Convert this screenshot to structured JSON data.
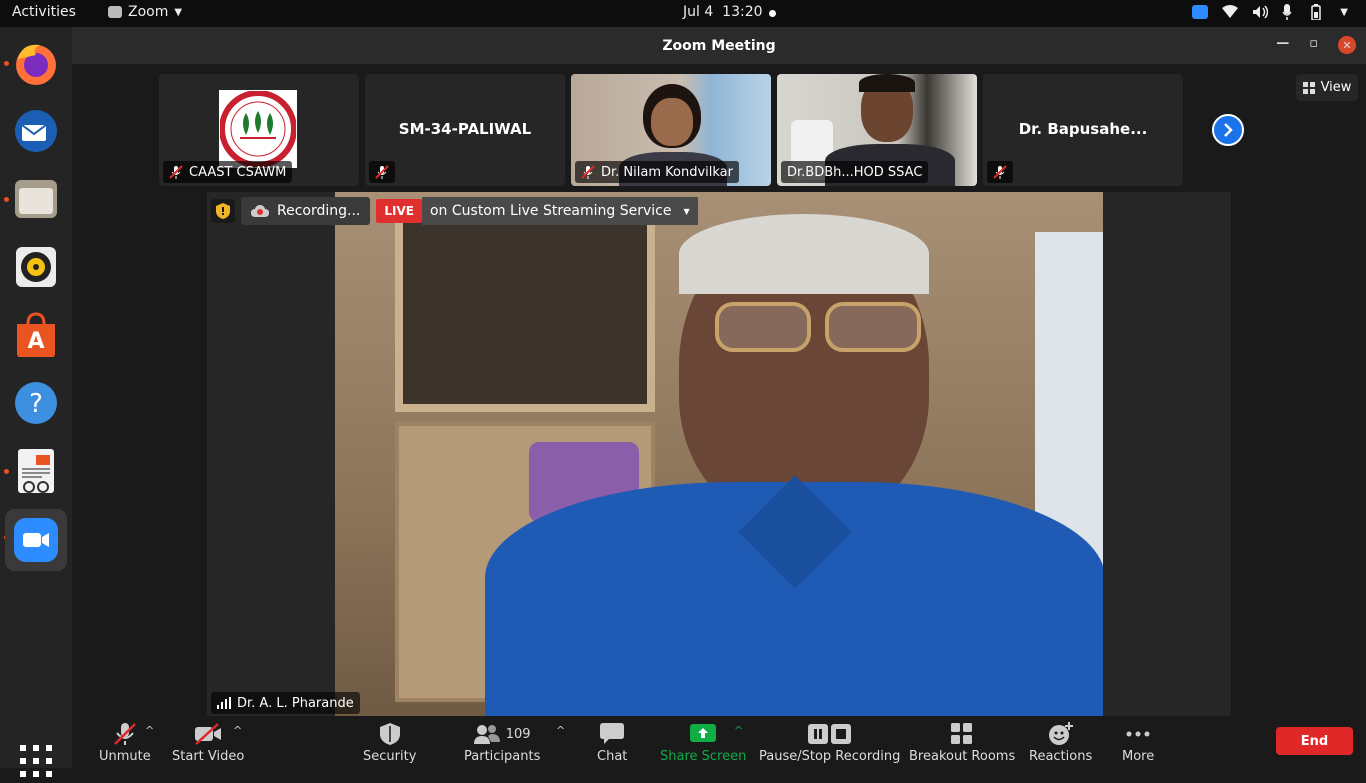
{
  "topbar": {
    "activities": "Activities",
    "app_menu": "Zoom",
    "date": "Jul 4",
    "time": "13:20"
  },
  "window": {
    "title": "Zoom Meeting"
  },
  "gallery": {
    "tiles": [
      {
        "name": "CAAST CSAWM",
        "logo_text": "अमुना सुर्ये"
      },
      {
        "name": "",
        "display": "SM-34-PALIWAL"
      },
      {
        "name": "Dr. Nilam Kondvilkar"
      },
      {
        "name": "Dr.BDBh...HOD SSAC"
      },
      {
        "name": "",
        "display": "Dr. Bapusahe..."
      }
    ],
    "view_label": "View"
  },
  "recording": {
    "label": "Recording...",
    "live": "LIVE",
    "service": "on Custom Live Streaming Service"
  },
  "speaker": {
    "name": "Dr. A. L. Pharande"
  },
  "toolbar": {
    "unmute": "Unmute",
    "start_video": "Start Video",
    "security": "Security",
    "participants": "Participants",
    "participant_count": "109",
    "chat": "Chat",
    "share_screen": "Share Screen",
    "pause_stop": "Pause/Stop Recording",
    "breakout": "Breakout Rooms",
    "reactions": "Reactions",
    "more": "More",
    "end": "End"
  },
  "colors": {
    "accent_blue": "#1a73e8",
    "end_red": "#e02828",
    "share_green": "#0fae45",
    "live_red": "#e02f2f"
  }
}
